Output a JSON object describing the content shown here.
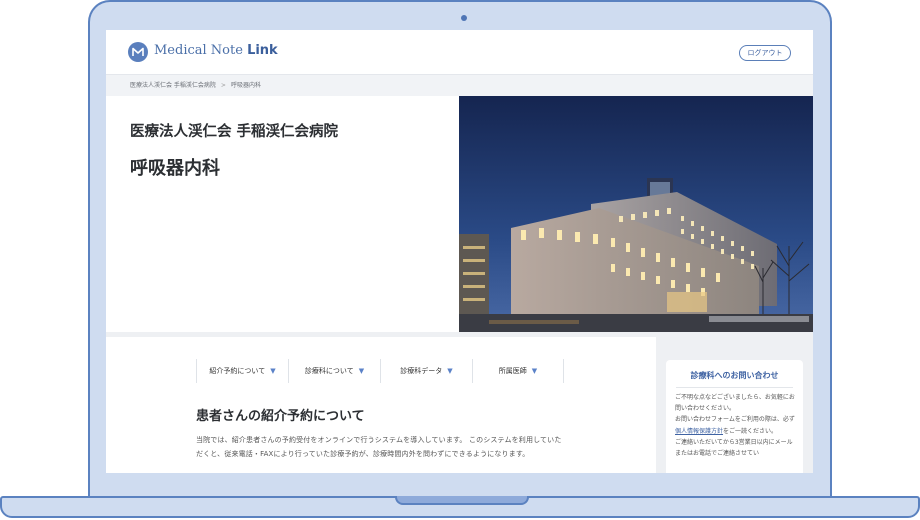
{
  "header": {
    "logo_text": "Medical Note ",
    "logo_bold": "Link",
    "logout_label": "ログアウト"
  },
  "breadcrumb": {
    "items": [
      "医療法人渓仁会 手稲渓仁会病院",
      "呼吸器内科"
    ],
    "separator": ">"
  },
  "hero": {
    "hospital_name": "医療法人渓仁会 手稲渓仁会病院",
    "department": "呼吸器内科"
  },
  "tabs": [
    {
      "label": "紹介予約について"
    },
    {
      "label": "診療科について"
    },
    {
      "label": "診療科データ"
    },
    {
      "label": "所属医師"
    }
  ],
  "main": {
    "section_title": "患者さんの紹介予約について",
    "body": "当院では、紹介患者さんの予約受付をオンラインで行うシステムを導入しています。 このシステムを利用していただくと、従来電話・FAXにより行っていた診療予約が、診療時間内外を問わずにできるようになります。"
  },
  "contact": {
    "title": "診療科へのお問い合わせ",
    "line1": "ご不明な点などございましたら、お気軽にお問い合わせください。",
    "line2_pre": "お問い合わせフォームをご利用の際は、必ず",
    "line2_link": "個人情報保護方針",
    "line2_post": "をご一読ください。",
    "line3": "ご連絡いただいてから3営業日以内にメールまたはお電話でご連絡させてい"
  },
  "colors": {
    "accent": "#3f63a3",
    "laptop_body": "#cfdcf0",
    "laptop_border": "#5b82c0"
  }
}
